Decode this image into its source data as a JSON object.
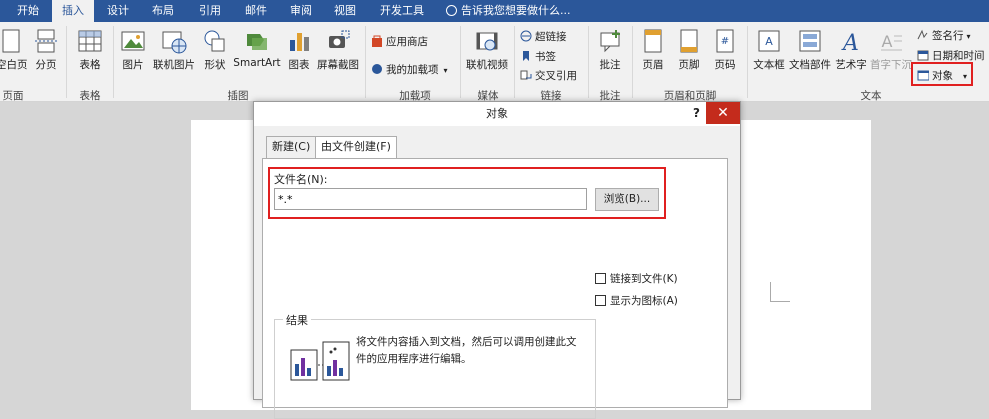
{
  "tabs": [
    {
      "label": "开始",
      "active": false
    },
    {
      "label": "插入",
      "active": true
    },
    {
      "label": "设计",
      "active": false
    },
    {
      "label": "布局",
      "active": false
    },
    {
      "label": "引用",
      "active": false
    },
    {
      "label": "邮件",
      "active": false
    },
    {
      "label": "审阅",
      "active": false
    },
    {
      "label": "视图",
      "active": false
    },
    {
      "label": "开发工具",
      "active": false
    }
  ],
  "tell_me": "告诉我您想要做什么...",
  "ribbon": {
    "pages": {
      "blank_page": "空白页",
      "page_break": "分页",
      "group": "页面"
    },
    "table": {
      "table": "表格",
      "group": "表格"
    },
    "illustrations": {
      "picture": "图片",
      "online_picture": "联机图片",
      "shapes": "形状",
      "smartart": "SmartArt",
      "chart": "图表",
      "screenshot": "屏幕截图",
      "group": "插图"
    },
    "addins": {
      "store": "应用商店",
      "my_addins": "我的加载项",
      "group": "加载项"
    },
    "media": {
      "online_video": "联机视频",
      "group": "媒体"
    },
    "links": {
      "hyperlink": "超链接",
      "bookmark": "书签",
      "cross_ref": "交叉引用",
      "group": "链接"
    },
    "comments": {
      "comment": "批注",
      "group": "批注"
    },
    "header_footer": {
      "header": "页眉",
      "footer": "页脚",
      "page_number": "页码",
      "group": "页眉和页脚"
    },
    "text": {
      "textbox": "文本框",
      "doc_parts": "文档部件",
      "wordart": "艺术字",
      "dropcap": "首字下沉",
      "signature": "签名行",
      "datetime": "日期和时间",
      "object": "对象",
      "group": "文本"
    }
  },
  "dialog": {
    "title": "对象",
    "help": "?",
    "close": "✕",
    "tab_new": "新建(C)",
    "tab_from_file": "由文件创建(F)",
    "filename_label": "文件名(N):",
    "filename_value": "*.*",
    "browse": "浏览(B)...",
    "link_to_file": "链接到文件(K)",
    "display_as_icon": "显示为图标(A)",
    "result_label": "结果",
    "result_text": "将文件内容插入到文档，然后可以调用创建此文件的应用程序进行编辑。"
  },
  "colors": {
    "accent": "#2b579a",
    "highlight": "#e02020"
  }
}
